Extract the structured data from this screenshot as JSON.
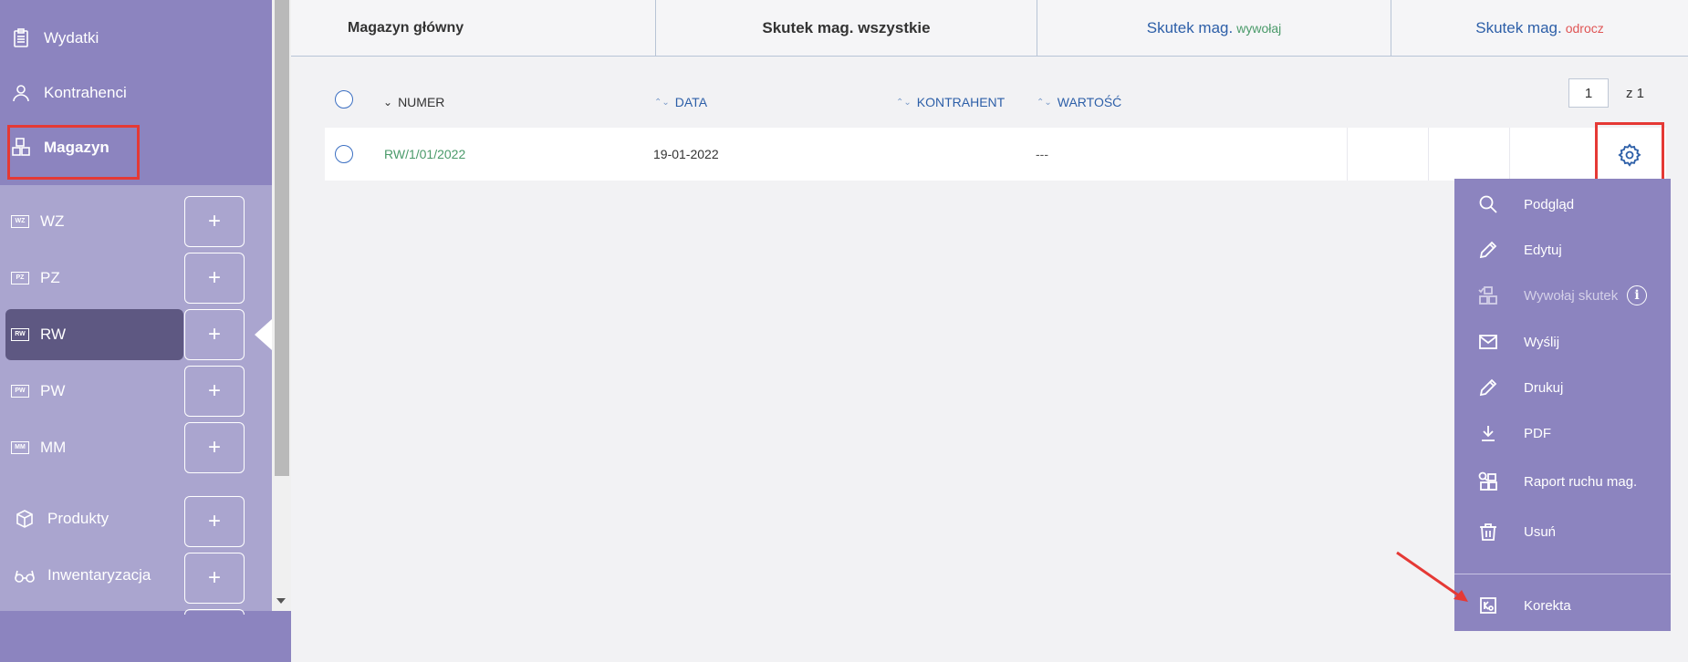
{
  "sidebar": {
    "top_items": [
      {
        "label": "Wydatki",
        "icon": "clipboard-icon"
      },
      {
        "label": "Kontrahenci",
        "icon": "user-icon"
      },
      {
        "label": "Magazyn",
        "icon": "boxes-icon"
      }
    ],
    "sub_items": [
      {
        "label": "WZ",
        "tag": "WZ"
      },
      {
        "label": "PZ",
        "tag": "PZ"
      },
      {
        "label": "RW",
        "tag": "RW",
        "active": true
      },
      {
        "label": "PW",
        "tag": "PW"
      },
      {
        "label": "MM",
        "tag": "MM"
      }
    ],
    "bottom_items": [
      {
        "label": "Produkty",
        "icon": "box-icon"
      },
      {
        "label": "Inwentaryzacja",
        "icon": "glasses-icon"
      }
    ],
    "plus_label": "+"
  },
  "tabs": [
    {
      "label": "Magazyn główny"
    },
    {
      "label": "Skutek mag. wszystkie"
    },
    {
      "label": "Skutek mag.",
      "sub": "wywołaj"
    },
    {
      "label": "Skutek mag.",
      "sub": "odrocz"
    }
  ],
  "table": {
    "columns": [
      "NUMER",
      "DATA",
      "KONTRAHENT",
      "WARTOŚĆ"
    ],
    "rows": [
      {
        "numer": "RW/1/01/2022",
        "data": "19-01-2022",
        "kontrahent": "",
        "wartosc": "---"
      }
    ]
  },
  "pager": {
    "page": "1",
    "of_label": "z 1"
  },
  "menu": {
    "items": [
      {
        "label": "Podgląd",
        "icon": "search-icon"
      },
      {
        "label": "Edytuj",
        "icon": "pencil-icon"
      },
      {
        "label": "Wywołaj skutek",
        "icon": "boxes-check-icon",
        "disabled": true
      },
      {
        "label": "Wyślij",
        "icon": "envelope-icon"
      },
      {
        "label": "Drukuj",
        "icon": "pencil-icon"
      },
      {
        "label": "PDF",
        "icon": "download-icon"
      },
      {
        "label": "Raport ruchu mag.",
        "icon": "boxes-search-icon"
      },
      {
        "label": "Usuń",
        "icon": "trash-icon"
      }
    ],
    "korekta": {
      "label": "Korekta",
      "icon": "korekta-icon"
    },
    "info_symbol": "i"
  },
  "colors": {
    "sidebar": "#8c84bf",
    "sidebar_light": "#aaa5cf",
    "link_blue": "#2d5fa8",
    "green": "#4a9a6a",
    "red": "#e05555",
    "highlight": "#e53935"
  }
}
